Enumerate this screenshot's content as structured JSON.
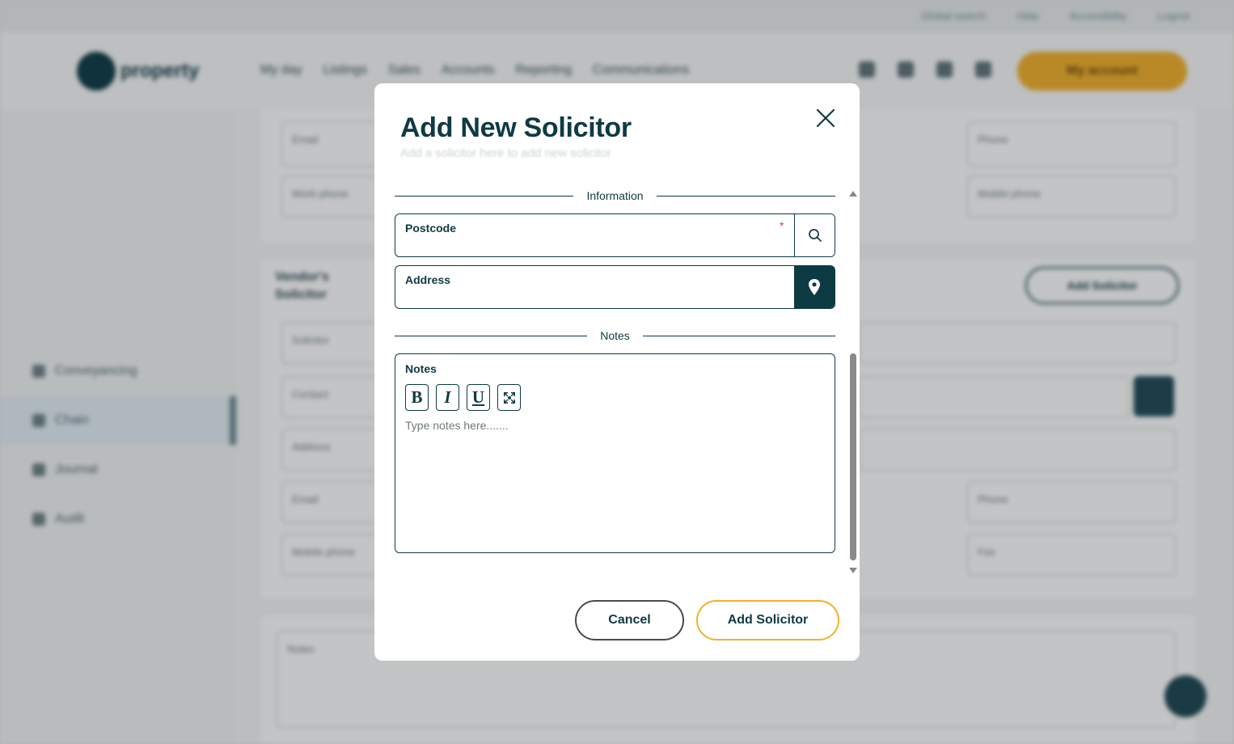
{
  "background": {
    "top_links": [
      "Global search",
      "Help",
      "Accessibility",
      "Logout"
    ],
    "logo_text": "property",
    "nav": [
      "My day",
      "Listings",
      "Sales",
      "Accounts",
      "Reporting",
      "Communications"
    ],
    "account_button": "My account",
    "sidebar": [
      "Conveyancing",
      "Chain",
      "Journal",
      "Audit"
    ],
    "sections": {
      "vendor_solicitor": "Vendor's Solicitor",
      "add_solicitor": "Add Solicitor",
      "fields": [
        "Email",
        "Work phone",
        "Phone",
        "Mobile phone",
        "Solicitor",
        "Contact",
        "Address",
        "Email",
        "Phone",
        "Mobile phone",
        "Fax",
        "Notes"
      ]
    }
  },
  "modal": {
    "title": "Add New Solicitor",
    "subtitle": "Add a solicitor here to add new solicitor",
    "sections": {
      "information": "Information",
      "notes": "Notes"
    },
    "postcode": {
      "label": "Postcode",
      "required_mark": "*",
      "value": ""
    },
    "address": {
      "label": "Address",
      "value": ""
    },
    "notes_field": {
      "label": "Notes",
      "placeholder": "Type notes here.......",
      "toolbar": {
        "bold": "B",
        "italic": "I",
        "underline": "U"
      }
    },
    "buttons": {
      "cancel": "Cancel",
      "add": "Add Solicitor"
    }
  },
  "colors": {
    "primary": "#0e3a44",
    "accent": "#f2b02b",
    "required": "#e53935"
  },
  "icons": [
    "close-icon",
    "search-icon",
    "location-pin-icon",
    "fullscreen-icon"
  ]
}
